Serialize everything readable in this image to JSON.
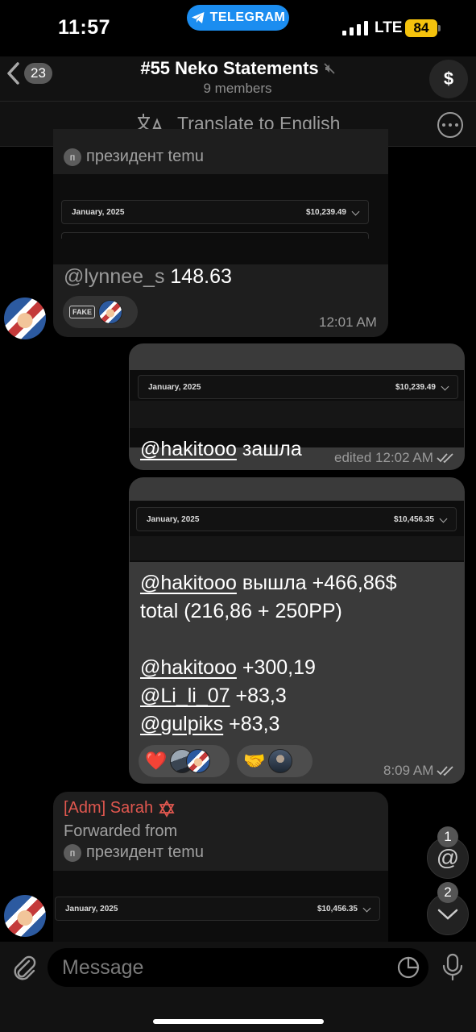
{
  "status_bar": {
    "time": "11:57",
    "app_pill": "TELEGRAM",
    "network": "LTE",
    "battery": "84"
  },
  "header": {
    "back_count": "23",
    "title": "#55 Neko Statements",
    "members": "9 members",
    "avatar_symbol": "$"
  },
  "translate_bar": {
    "label": "Translate to English"
  },
  "messages": [
    {
      "forwarded_from": "президент temu",
      "statement": {
        "month": "January, 2025",
        "amount": "$10,239.49"
      },
      "mention": "@lynnee_s",
      "text": "148.63",
      "fake_label": "FAKE",
      "time": "12:01 AM"
    },
    {
      "statement": {
        "month": "January, 2025",
        "amount": "$10,239.49"
      },
      "mention": "@hakitooo",
      "text": "зашла",
      "time": "edited 12:02 AM"
    },
    {
      "statement": {
        "month": "January, 2025",
        "amount": "$10,456.35"
      },
      "lines": [
        {
          "mention": "@hakitooo",
          "text": "вышла +466,86$"
        },
        {
          "mention": "",
          "text": "total (216,86 + 250PP)"
        },
        {
          "mention": "@hakitooo",
          "text": "+300,19"
        },
        {
          "mention": "@Li_li_07",
          "text": "+83,3"
        },
        {
          "mention": "@gulpiks",
          "text": "+83,3"
        }
      ],
      "reactions": [
        "❤️",
        "🤝"
      ],
      "time": "8:09 AM"
    },
    {
      "sender": "[Adm] Sarah",
      "sender_color": "#e0574f",
      "forwarded_label": "Forwarded from",
      "forwarded_from": "президент temu",
      "statement": {
        "month": "January, 2025",
        "amount": "$10,456.35"
      }
    }
  ],
  "fabs": {
    "mentions_count": "1",
    "scroll_down_count": "2"
  },
  "input": {
    "placeholder": "Message"
  },
  "colors": {
    "accent": "#1b8df0",
    "battery": "#f4c20d",
    "sender": "#e0574f"
  }
}
